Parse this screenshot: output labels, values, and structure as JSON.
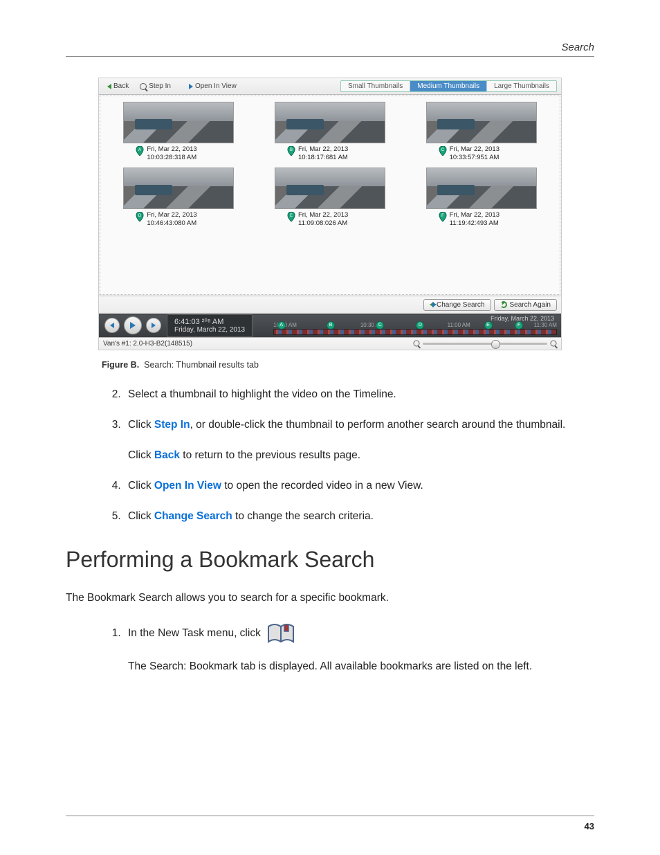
{
  "header": {
    "section": "Search"
  },
  "app": {
    "toolbar": {
      "back": "Back",
      "step_in": "Step In",
      "open_in_view": "Open In View",
      "seg_small": "Small Thumbnails",
      "seg_medium": "Medium Thumbnails",
      "seg_large": "Large Thumbnails"
    },
    "thumbs": [
      {
        "marker": "A",
        "date": "Fri, Mar 22, 2013",
        "time": "10:03:28:318 AM"
      },
      {
        "marker": "B",
        "date": "Fri, Mar 22, 2013",
        "time": "10:18:17:681 AM"
      },
      {
        "marker": "C",
        "date": "Fri, Mar 22, 2013",
        "time": "10:33:57:951 AM"
      },
      {
        "marker": "D",
        "date": "Fri, Mar 22, 2013",
        "time": "10:46:43:080 AM"
      },
      {
        "marker": "E",
        "date": "Fri, Mar 22, 2013",
        "time": "11:09:08:026 AM"
      },
      {
        "marker": "F",
        "date": "Fri, Mar 22, 2013",
        "time": "11:19:42:493 AM"
      }
    ],
    "change_search": "Change Search",
    "search_again": "Search Again",
    "playbar": {
      "time_main": "6:41:03 ²⁰⁸ AM",
      "time_sub": "Friday, March 22, 2013",
      "timeline_date": "Friday, March 22, 2013",
      "ticks": [
        "10:00 AM",
        "10:30 AM",
        "11:00 AM",
        "11:30 AM"
      ]
    },
    "status_camera": "Van's #1: 2.0-H3-B2(148515)"
  },
  "caption_label": "Figure B.",
  "caption_text": "Search: Thumbnail results tab",
  "steps": {
    "s2": "Select a thumbnail to highlight the video on the Timeline.",
    "s3a_pre": "Click ",
    "s3a_link": "Step In",
    "s3a_post": ", or double-click the thumbnail to perform another search around the thumbnail.",
    "s3b_pre": "Click ",
    "s3b_link": "Back",
    "s3b_post": " to return to the previous results page.",
    "s4_pre": "Click ",
    "s4_link": "Open In View",
    "s4_post": " to open the recorded video in a new View.",
    "s5_pre": "Click ",
    "s5_link": "Change Search",
    "s5_post": " to change the search criteria."
  },
  "section_heading": "Performing a Bookmark Search",
  "section_intro": "The Bookmark Search allows you to search for a specific bookmark.",
  "bm_step1_pre": "In the New Task menu, click",
  "bm_step1_post": "The Search: Bookmark tab is displayed. All available bookmarks are listed on the left.",
  "page_number": "43"
}
